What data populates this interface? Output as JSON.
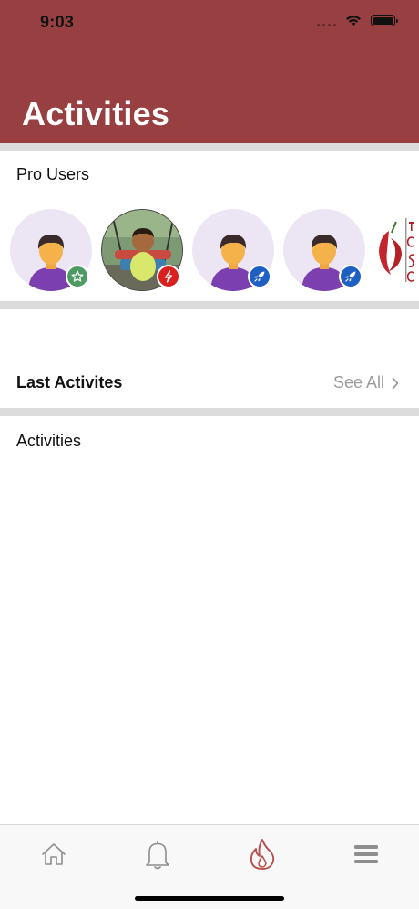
{
  "status_bar": {
    "time": "9:03"
  },
  "header": {
    "title": "Activities",
    "background": "#973f41"
  },
  "pro_users": {
    "title": "Pro Users",
    "users": [
      {
        "avatar": "default-person-avatar",
        "badge": "star-icon",
        "badge_color": "#4d9b63"
      },
      {
        "avatar": "child-photo-avatar",
        "badge": "lightning-icon",
        "badge_color": "#d8201f"
      },
      {
        "avatar": "default-person-avatar",
        "badge": "rocket-icon",
        "badge_color": "#1e5fc4"
      },
      {
        "avatar": "default-person-avatar",
        "badge": "rocket-icon",
        "badge_color": "#1e5fc4"
      },
      {
        "avatar": "partial-logo-avatar",
        "badge": "",
        "badge_color": ""
      }
    ]
  },
  "last_activities": {
    "title": "Last Activites",
    "see_all": "See All"
  },
  "activities": {
    "title": "Activities"
  },
  "tab_bar": {
    "active_color": "#b84a48",
    "tabs": [
      {
        "icon": "home-icon",
        "active": false
      },
      {
        "icon": "bell-icon",
        "active": false
      },
      {
        "icon": "flame-icon",
        "active": true
      },
      {
        "icon": "menu-icon",
        "active": false
      }
    ]
  }
}
